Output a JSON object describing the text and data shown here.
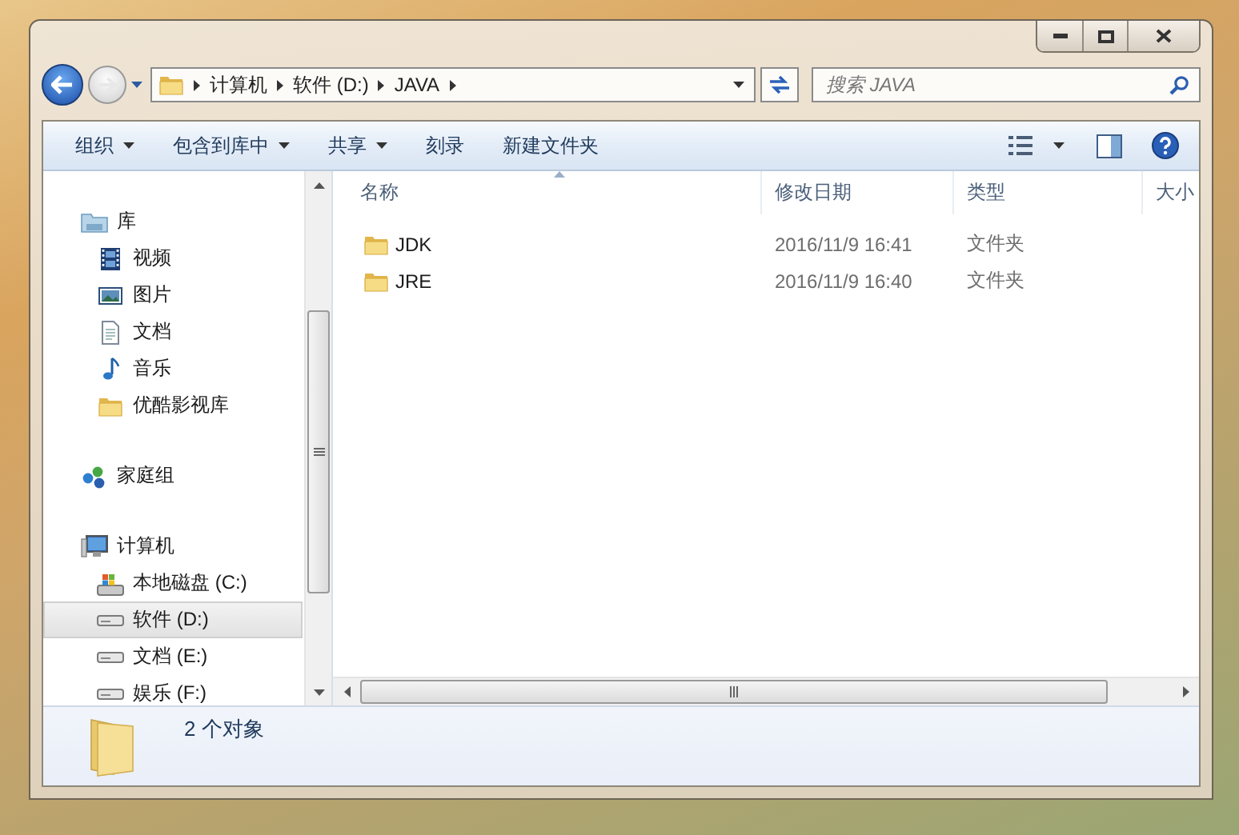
{
  "address_bar": {
    "breadcrumbs": [
      "计算机",
      "软件 (D:)",
      "JAVA"
    ]
  },
  "search": {
    "placeholder": "搜索 JAVA"
  },
  "toolbar": {
    "buttons": [
      {
        "label": "组织",
        "dropdown": true
      },
      {
        "label": "包含到库中",
        "dropdown": true
      },
      {
        "label": "共享",
        "dropdown": true
      },
      {
        "label": "刻录",
        "dropdown": false
      },
      {
        "label": "新建文件夹",
        "dropdown": false
      }
    ]
  },
  "sidebar": {
    "groups": [
      {
        "label": "库",
        "kind": "library",
        "selected": false,
        "children": [
          {
            "label": "视频",
            "kind": "video",
            "selected": false
          },
          {
            "label": "图片",
            "kind": "picture",
            "selected": false
          },
          {
            "label": "文档",
            "kind": "document",
            "selected": false
          },
          {
            "label": "音乐",
            "kind": "music",
            "selected": false
          },
          {
            "label": "优酷影视库",
            "kind": "folder",
            "selected": false
          }
        ]
      },
      {
        "label": "家庭组",
        "kind": "homegroup",
        "selected": false
      },
      {
        "label": "计算机",
        "kind": "computer",
        "selected": false,
        "children": [
          {
            "label": "本地磁盘 (C:)",
            "kind": "system-drive",
            "selected": false
          },
          {
            "label": "软件 (D:)",
            "kind": "drive",
            "selected": true
          },
          {
            "label": "文档 (E:)",
            "kind": "drive",
            "selected": false
          },
          {
            "label": "娱乐 (F:)",
            "kind": "drive",
            "selected": false
          }
        ]
      }
    ]
  },
  "file_list": {
    "columns": [
      "名称",
      "修改日期",
      "类型",
      "大小"
    ],
    "rows": [
      {
        "name": "JDK",
        "modified": "2016/11/9 16:41",
        "type": "文件夹",
        "selected": false
      },
      {
        "name": "JRE",
        "modified": "2016/11/9 16:40",
        "type": "文件夹",
        "selected": false
      }
    ]
  },
  "status_bar": {
    "text": "2 个对象"
  }
}
